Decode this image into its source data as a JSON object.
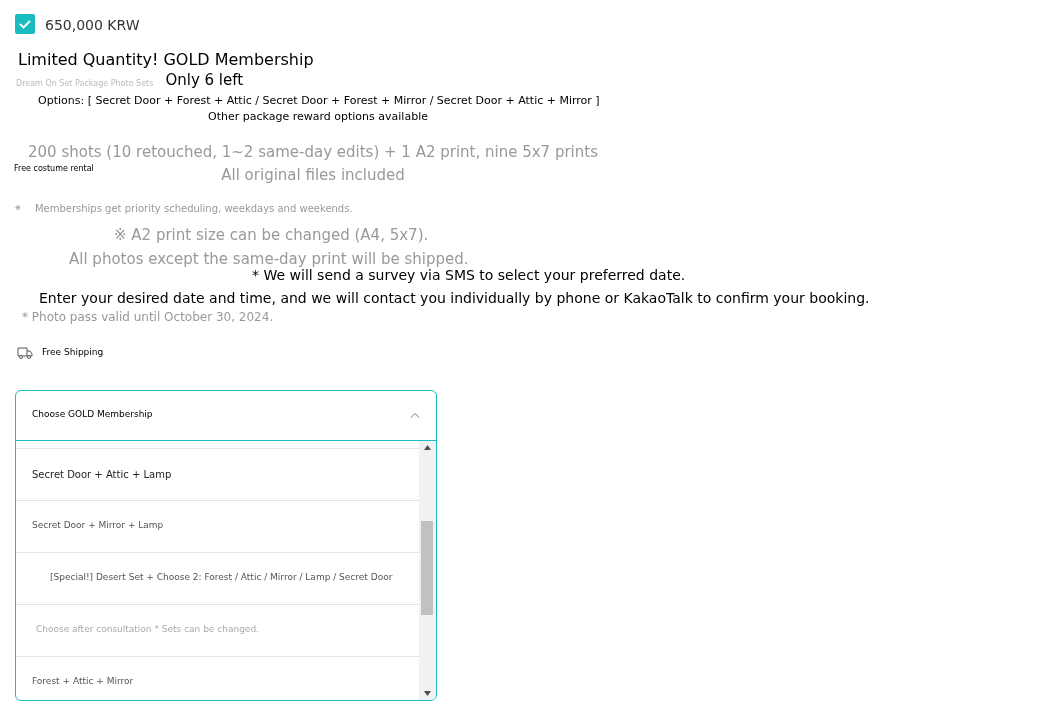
{
  "price": {
    "checked": true,
    "label": "650,000 KRW"
  },
  "title": "Limited Quantity! GOLD Membership",
  "subtitle": "Dream On Set Package Photo Sets",
  "stock": "Only 6 left",
  "options_line": "Options: [ Secret Door + Forest + Attic / Secret Door + Forest + Mirror / Secret Door + Attic + Mirror ]",
  "other_options": "Other package reward options available",
  "costume": "Free costume rental",
  "shots": "200 shots (10 retouched, 1~2 same-day edits) + 1 A2 print, nine 5x7 prints",
  "original_files": "All original files included",
  "note_mark": "※",
  "priority": "Memberships get priority scheduling, weekdays and weekends.",
  "print_size": "※ A2 print size can be changed (A4, 5x7).",
  "shipping_note": "All photos except the same-day print will be shipped.",
  "survey": "* We will send a survey via SMS to select your preferred date.",
  "contact": "Enter your desired date and time, and we will contact you individually by phone or KakaoTalk to confirm your booking.",
  "valid": "* Photo pass valid until October 30, 2024.",
  "shipping": "Free Shipping",
  "dropdown": {
    "label": "Choose GOLD Membership",
    "expanded": true,
    "options": [
      {
        "label": "Secret Door + Attic + Lamp",
        "kind": "strong"
      },
      {
        "label": "Secret Door + Mirror + Lamp",
        "kind": "normal"
      },
      {
        "label": "[Special!] Desert Set + Choose 2: Forest / Attic / Mirror / Lamp / Secret Door",
        "kind": "indented"
      },
      {
        "label": "Choose after consultation * Sets can be changed.",
        "kind": "muted"
      },
      {
        "label": "Forest + Attic + Mirror",
        "kind": "normal"
      }
    ]
  }
}
